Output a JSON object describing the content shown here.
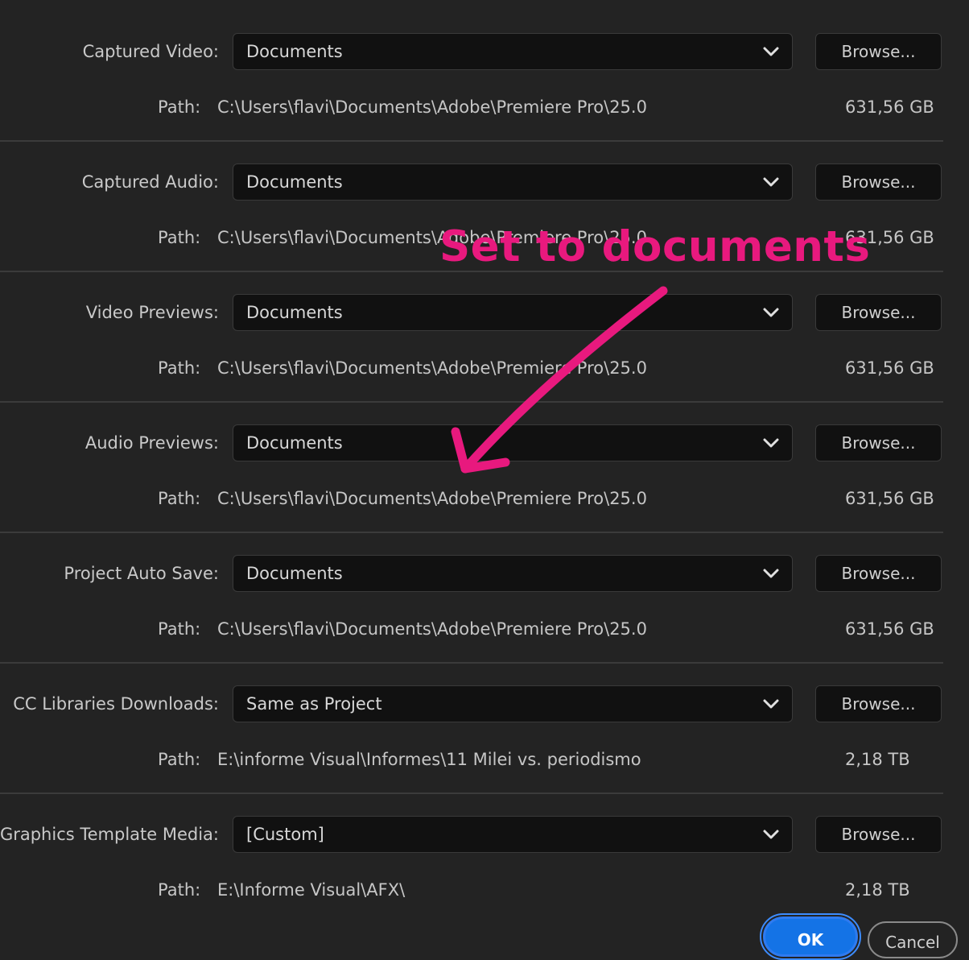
{
  "rows": [
    {
      "label": "Captured Video:",
      "value": "Documents",
      "browse": "Browse...",
      "path_label": "Path:",
      "path": "C:\\Users\\flavi\\Documents\\Adobe\\Premiere Pro\\25.0",
      "size": "631,56 GB"
    },
    {
      "label": "Captured Audio:",
      "value": "Documents",
      "browse": "Browse...",
      "path_label": "Path:",
      "path": "C:\\Users\\flavi\\Documents\\Adobe\\Premiere Pro\\25.0",
      "size": "631,56 GB"
    },
    {
      "label": "Video Previews:",
      "value": "Documents",
      "browse": "Browse...",
      "path_label": "Path:",
      "path": "C:\\Users\\flavi\\Documents\\Adobe\\Premiere Pro\\25.0",
      "size": "631,56 GB"
    },
    {
      "label": "Audio Previews:",
      "value": "Documents",
      "browse": "Browse...",
      "path_label": "Path:",
      "path": "C:\\Users\\flavi\\Documents\\Adobe\\Premiere Pro\\25.0",
      "size": "631,56 GB"
    },
    {
      "label": "Project Auto Save:",
      "value": "Documents",
      "browse": "Browse...",
      "path_label": "Path:",
      "path": "C:\\Users\\flavi\\Documents\\Adobe\\Premiere Pro\\25.0",
      "size": "631,56 GB"
    },
    {
      "label": "CC Libraries Downloads:",
      "value": "Same as Project",
      "browse": "Browse...",
      "path_label": "Path:",
      "path": "E:\\informe Visual\\Informes\\11 Milei vs. periodismo",
      "size": "2,18 TB"
    },
    {
      "label": "n Graphics Template Media:",
      "value": "[Custom]",
      "browse": "Browse...",
      "path_label": "Path:",
      "path": "E:\\Informe Visual\\AFX\\",
      "size": "2,18 TB"
    }
  ],
  "annotation": {
    "text": "Set to documents",
    "color": "#e8197e"
  },
  "footer": {
    "ok_label": "OK",
    "cancel_label": "Cancel"
  },
  "colors": {
    "background": "#232323",
    "field": "#111111",
    "accent": "#1473e6"
  },
  "icons": {
    "dropdown": "chevron-down-icon",
    "arrow": "arrow-annotation-icon"
  }
}
